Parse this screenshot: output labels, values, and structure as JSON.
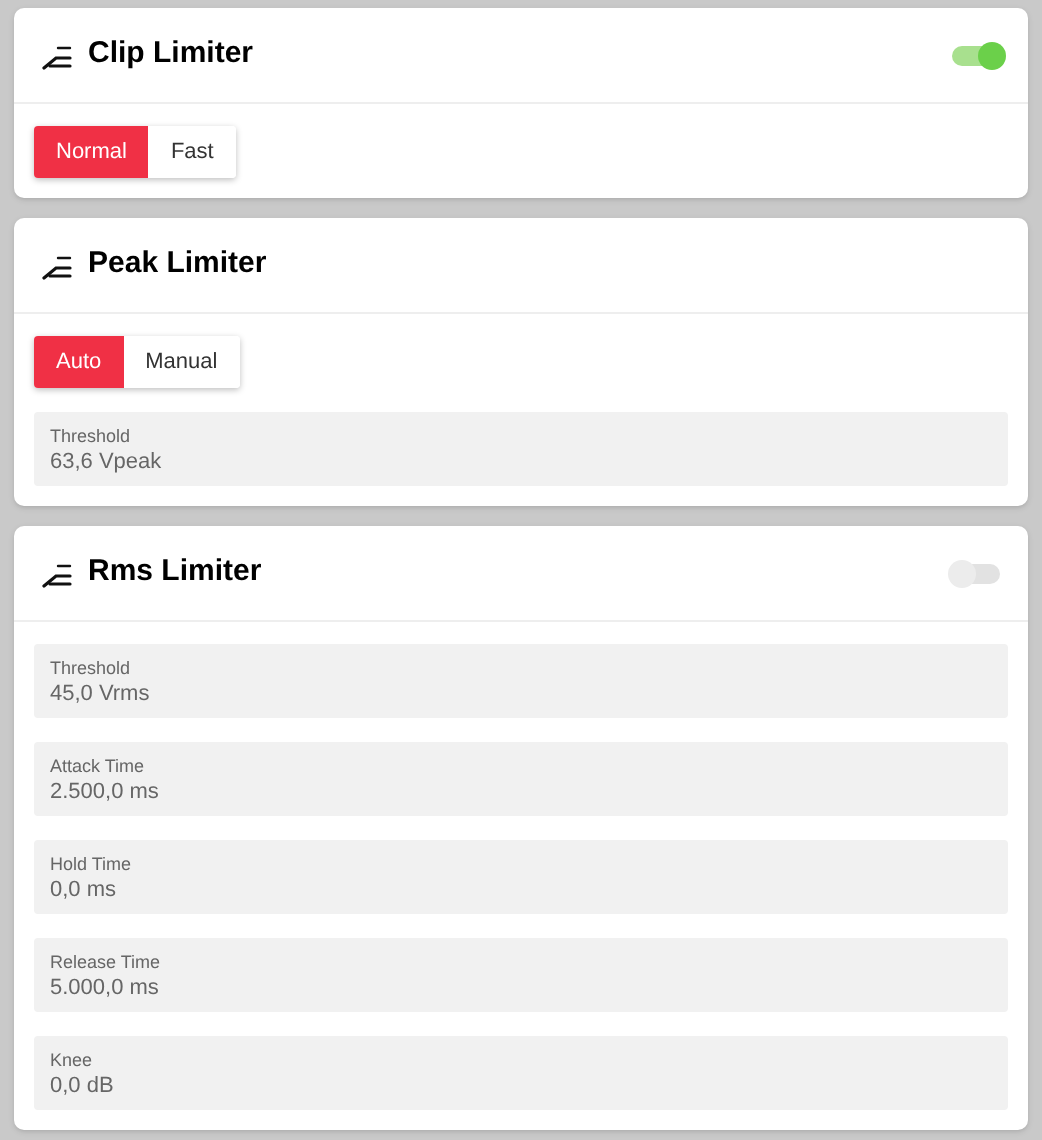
{
  "panels": [
    {
      "title": "Clip Limiter",
      "toggle": {
        "on": true
      },
      "modes": [
        {
          "label": "Normal",
          "selected": true
        },
        {
          "label": "Fast",
          "selected": false
        }
      ]
    },
    {
      "title": "Peak Limiter",
      "modes": [
        {
          "label": "Auto",
          "selected": true
        },
        {
          "label": "Manual",
          "selected": false
        }
      ],
      "fields": [
        {
          "label": "Threshold",
          "value": "63,6 Vpeak"
        }
      ]
    },
    {
      "title": "Rms Limiter",
      "toggle": {
        "on": false
      },
      "fields": [
        {
          "label": "Threshold",
          "value": "45,0 Vrms"
        },
        {
          "label": "Attack Time",
          "value": "2.500,0 ms"
        },
        {
          "label": "Hold Time",
          "value": "0,0 ms"
        },
        {
          "label": "Release Time",
          "value": "5.000,0 ms"
        },
        {
          "label": "Knee",
          "value": "0,0 dB"
        }
      ]
    }
  ]
}
